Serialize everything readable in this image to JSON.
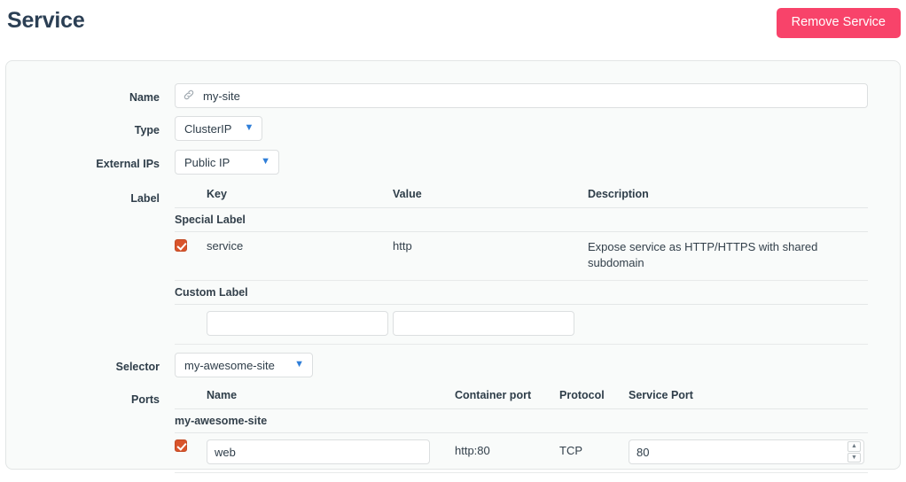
{
  "header": {
    "title": "Service",
    "remove_button": "Remove Service"
  },
  "form": {
    "name": {
      "label": "Name",
      "value": "my-site",
      "placeholder": "",
      "icon": "link-icon"
    },
    "type": {
      "label": "Type",
      "value": "ClusterIP"
    },
    "external_ips": {
      "label": "External IPs",
      "value": "Public IP"
    },
    "label_section": {
      "label": "Label",
      "columns": [
        "Key",
        "Value",
        "Description"
      ],
      "groups": [
        {
          "name": "Special Label",
          "rows": [
            {
              "checked": true,
              "key": "service",
              "value": "http",
              "description": "Expose service as HTTP/HTTPS with shared subdomain"
            }
          ]
        },
        {
          "name": "Custom Label",
          "input_rows": [
            {
              "key_value": "",
              "key_placeholder": "",
              "value_value": "",
              "value_placeholder": ""
            }
          ]
        }
      ]
    },
    "selector": {
      "label": "Selector",
      "value": "my-awesome-site"
    },
    "ports_section": {
      "label": "Ports",
      "columns": [
        "Name",
        "Container port",
        "Protocol",
        "Service Port"
      ],
      "groups": [
        {
          "name": "my-awesome-site",
          "rows": [
            {
              "checked": true,
              "name": "web",
              "container_port": "http:80",
              "protocol": "TCP",
              "service_port": "80"
            }
          ]
        }
      ]
    }
  },
  "colors": {
    "accent_danger": "#f8436a",
    "checkbox": "#d9542b",
    "chevron": "#2f7ed8",
    "title": "#2b3f54",
    "card_bg": "#f9fbfa",
    "card_border": "#e2e5e5"
  },
  "icons": {
    "link": "link-icon",
    "chevron_down": "chevron-down-icon",
    "spinner_up": "spinner-up-icon",
    "spinner_down": "spinner-down-icon",
    "check": "check-icon"
  }
}
